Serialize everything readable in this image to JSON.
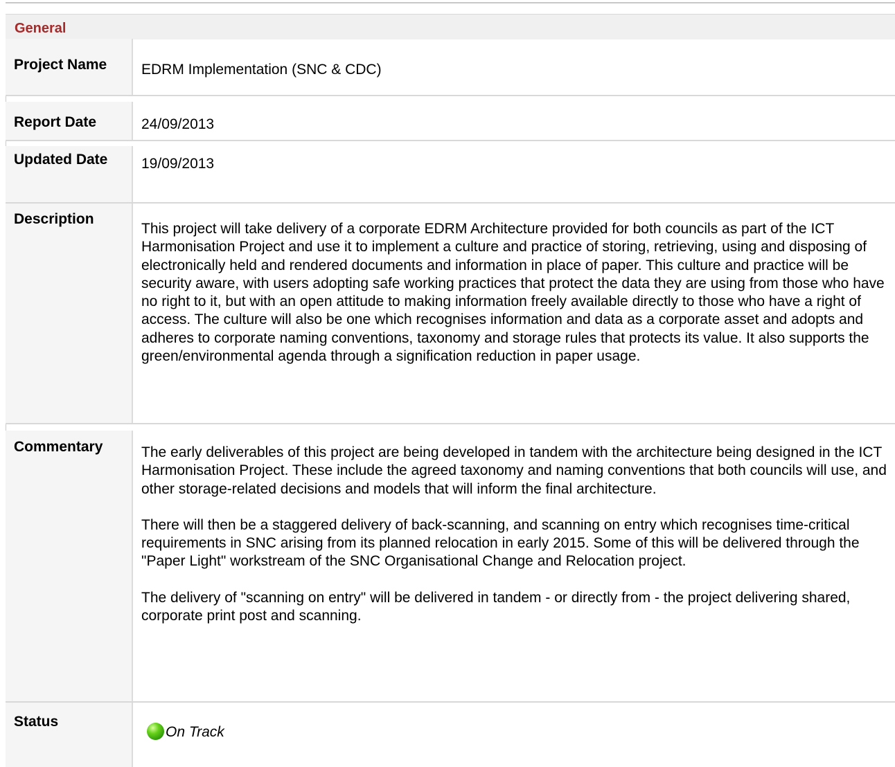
{
  "section": {
    "title": "General"
  },
  "fields": {
    "project_name": {
      "label": "Project Name",
      "value": "EDRM Implementation (SNC & CDC)"
    },
    "report_date": {
      "label": "Report Date",
      "value": "24/09/2013"
    },
    "updated_date": {
      "label": "Updated Date",
      "value": "19/09/2013"
    },
    "description": {
      "label": "Description",
      "value": "This project will take delivery of a corporate EDRM Architecture provided for both councils as part of the ICT Harmonisation Project and use it to implement a culture and practice of storing, retrieving, using and disposing of electronically held and rendered documents and information in place of paper. This culture and practice will be security aware, with users adopting safe working practices that protect the data they are using from those who have no right to it, but with an open attitude to making information freely available directly to those who have a right of access. The culture will also be one which recognises information and data as a corporate asset and adopts and adheres to corporate naming conventions, taxonomy and storage rules that protects its value. It also supports the green/environmental agenda through a signification reduction in paper usage."
    },
    "commentary": {
      "label": "Commentary",
      "paragraphs": [
        "The early deliverables of this project are being developed in tandem with the architecture being designed in the ICT Harmonisation Project. These include the agreed taxonomy and naming conventions that both councils will use, and other storage-related decisions and models that will inform the final architecture.",
        "There will then be a staggered delivery of back-scanning, and scanning on entry which recognises time-critical requirements in SNC arising from its planned relocation in early 2015. Some of this will be delivered through the \"Paper Light\" workstream of the SNC Organisational Change and Relocation project.",
        "The delivery of \"scanning on entry\" will be delivered in tandem - or directly from - the project delivering shared, corporate print post and scanning."
      ]
    },
    "status": {
      "label": "Status",
      "value": "On Track",
      "icon": "green-status-indicator-icon",
      "color": "#3fb414"
    }
  },
  "colors": {
    "section_title": "#a52a2a",
    "header_background": "#f0f0f0",
    "label_background": "#f5f5f5",
    "divider": "#d8d8d8"
  }
}
